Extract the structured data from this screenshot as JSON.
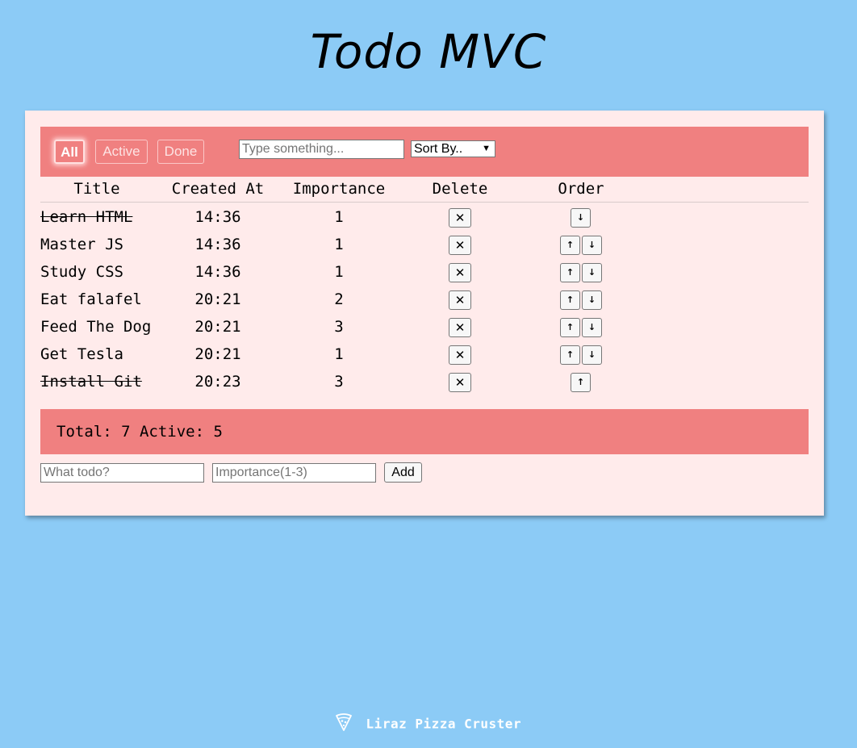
{
  "app": {
    "title": "Todo MVC"
  },
  "filters": {
    "items": [
      {
        "label": "All",
        "active": true
      },
      {
        "label": "Active",
        "active": false
      },
      {
        "label": "Done",
        "active": false
      }
    ],
    "search_placeholder": "Type something...",
    "search_value": "",
    "sort_selected": "Sort By.."
  },
  "table": {
    "headers": [
      "Title",
      "Created At",
      "Importance",
      "Delete",
      "Order"
    ],
    "rows": [
      {
        "title": "Learn HTML",
        "created_at": "14:36",
        "importance": "1",
        "done": true,
        "can_move_up": false,
        "can_move_down": true
      },
      {
        "title": "Master JS",
        "created_at": "14:36",
        "importance": "1",
        "done": false,
        "can_move_up": true,
        "can_move_down": true
      },
      {
        "title": "Study CSS",
        "created_at": "14:36",
        "importance": "1",
        "done": false,
        "can_move_up": true,
        "can_move_down": true
      },
      {
        "title": "Eat falafel",
        "created_at": "20:21",
        "importance": "2",
        "done": false,
        "can_move_up": true,
        "can_move_down": true
      },
      {
        "title": "Feed The Dog",
        "created_at": "20:21",
        "importance": "3",
        "done": false,
        "can_move_up": true,
        "can_move_down": true
      },
      {
        "title": "Get Tesla",
        "created_at": "20:21",
        "importance": "1",
        "done": false,
        "can_move_up": true,
        "can_move_down": true
      },
      {
        "title": "Install Git",
        "created_at": "20:23",
        "importance": "3",
        "done": true,
        "can_move_up": true,
        "can_move_down": false
      }
    ],
    "delete_glyph": "✕",
    "up_glyph": "↑",
    "down_glyph": "↓"
  },
  "stats": {
    "text": "Total: 7 Active: 5"
  },
  "add_form": {
    "title_placeholder": "What todo?",
    "importance_placeholder": "Importance(1-3)",
    "add_label": "Add"
  },
  "footer": {
    "label": "Liraz Pizza Cruster",
    "icon": "pizza-icon"
  },
  "colors": {
    "background": "#8ccbf6",
    "card": "#ffebeb",
    "accent": "#f08080"
  }
}
